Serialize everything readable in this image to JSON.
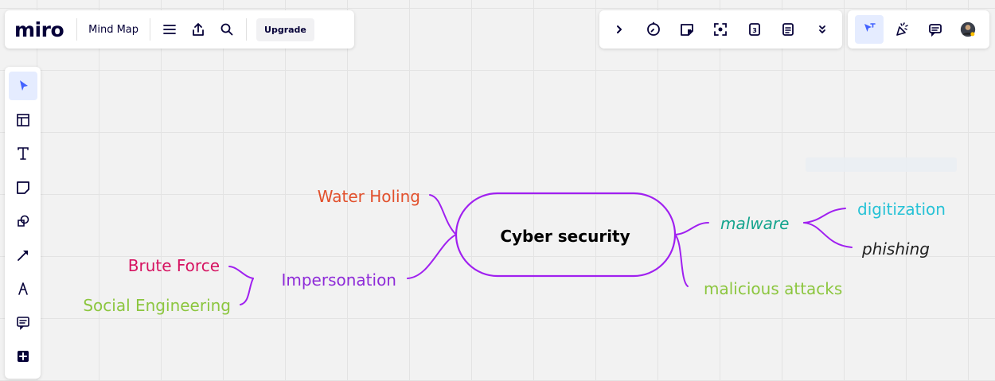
{
  "header": {
    "logo": "miro",
    "board_name": "Mind Map",
    "upgrade_label": "Upgrade",
    "icons": [
      "menu-icon",
      "export-icon",
      "search-icon"
    ]
  },
  "toolbar_right": {
    "icons": [
      "chevron-right-icon",
      "timer-icon",
      "card-icon",
      "focus-icon",
      "calendar-icon",
      "notes-icon",
      "chevron-down-double-icon"
    ]
  },
  "toolbar_collab": {
    "icons": [
      "cursor-select-icon",
      "reactions-icon",
      "comments-icon",
      "user-avatar"
    ],
    "accent_color": "#4262ff"
  },
  "left_toolbar": {
    "tools": [
      "select-icon",
      "templates-icon",
      "text-icon",
      "sticky-note-icon",
      "shapes-icon",
      "connector-icon",
      "pen-icon",
      "comment-icon",
      "more-tools-icon"
    ]
  },
  "mindmap": {
    "root": {
      "label": "Cyber security",
      "color": "#000000",
      "stroke": "#a020f0"
    },
    "nodes": [
      {
        "id": "water-holing",
        "label": "Water Holing",
        "color": "#e2502c"
      },
      {
        "id": "impersonation",
        "label": "Impersonation",
        "color": "#8e2bd8"
      },
      {
        "id": "brute-force",
        "label": "Brute Force",
        "color": "#d61361"
      },
      {
        "id": "social-engineering",
        "label": "Social Engineering",
        "color": "#8cc63f"
      },
      {
        "id": "malware",
        "label": "malware",
        "color": "#13a48d"
      },
      {
        "id": "digitization",
        "label": "digitization",
        "color": "#27c2d6"
      },
      {
        "id": "phishing",
        "label": "phishing",
        "color": "#222222"
      },
      {
        "id": "malicious-attacks",
        "label": "malicious attacks",
        "color": "#8cc63f"
      }
    ],
    "branch_color": "#a020f0"
  }
}
